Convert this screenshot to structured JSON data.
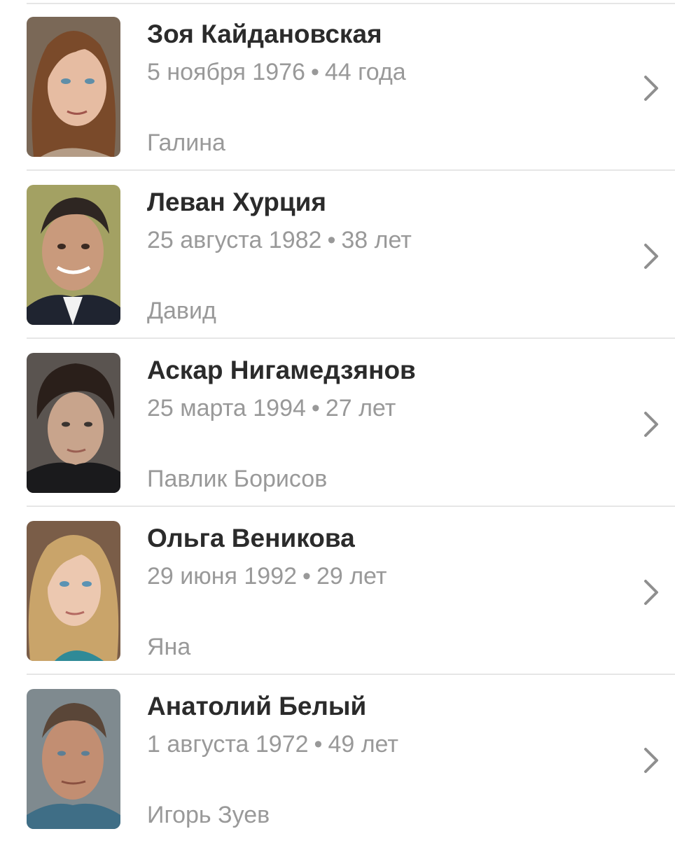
{
  "cast": [
    {
      "name": "Зоя Кайдановская",
      "birth_date": "5 ноября 1976",
      "separator": "•",
      "age": "44 года",
      "role": "Галина"
    },
    {
      "name": "Леван Хурция",
      "birth_date": "25 августа 1982",
      "separator": "•",
      "age": "38 лет",
      "role": "Давид"
    },
    {
      "name": "Аскар Нигамедзянов",
      "birth_date": "25 марта 1994",
      "separator": "•",
      "age": "27 лет",
      "role": "Павлик Борисов"
    },
    {
      "name": "Ольга Веникова",
      "birth_date": "29 июня 1992",
      "separator": "•",
      "age": "29 лет",
      "role": "Яна"
    },
    {
      "name": "Анатолий Белый",
      "birth_date": "1 августа 1972",
      "separator": "•",
      "age": "49 лет",
      "role": "Игорь Зуев"
    }
  ]
}
